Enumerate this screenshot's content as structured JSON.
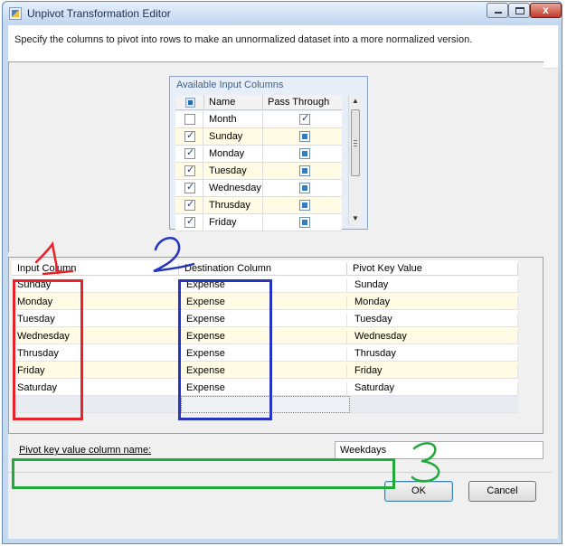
{
  "window": {
    "title": "Unpivot Transformation Editor",
    "close_glyph": "x"
  },
  "instruction": "Specify the columns to pivot into rows to make an unnormalized dataset into a more normalized version.",
  "available_columns": {
    "title": "Available Input Columns",
    "header_name": "Name",
    "header_pass": "Pass Through",
    "rows": [
      {
        "name": "Month",
        "selected": false,
        "pass_through": true
      },
      {
        "name": "Sunday",
        "selected": true,
        "pass_through": false
      },
      {
        "name": "Monday",
        "selected": true,
        "pass_through": false
      },
      {
        "name": "Tuesday",
        "selected": true,
        "pass_through": false
      },
      {
        "name": "Wednesday",
        "selected": true,
        "pass_through": false
      },
      {
        "name": "Thrusday",
        "selected": true,
        "pass_through": false
      },
      {
        "name": "Friday",
        "selected": true,
        "pass_through": false
      }
    ]
  },
  "grid": {
    "headers": [
      "Input Column",
      "Destination Column",
      "Pivot Key Value"
    ],
    "rows": [
      [
        "Sunday",
        "Expense",
        "Sunday"
      ],
      [
        "Monday",
        "Expense",
        "Monday"
      ],
      [
        "Tuesday",
        "Expense",
        "Tuesday"
      ],
      [
        "Wednesday",
        "Expense",
        "Wednesday"
      ],
      [
        "Thrusday",
        "Expense",
        "Thrusday"
      ],
      [
        "Friday",
        "Expense",
        "Friday"
      ],
      [
        "Saturday",
        "Expense",
        "Saturday"
      ]
    ]
  },
  "pivot_key": {
    "label": "Pivot key value column name:",
    "value": "Weekdays"
  },
  "buttons": {
    "ok": "OK",
    "cancel": "Cancel"
  },
  "annotations": {
    "colors": {
      "red": "#e8222a",
      "blue": "#2634c0",
      "green": "#1faa3a"
    }
  }
}
